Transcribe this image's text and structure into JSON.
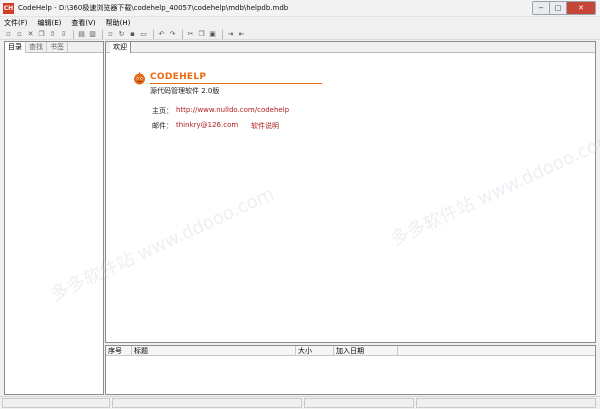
{
  "window": {
    "icon_text": "CH",
    "title": "CodeHelp - D:\\360极速浏览器下载\\codehelp_40057\\codehelp\\mdb\\helpdb.mdb",
    "minimize": "−",
    "maximize": "□",
    "close": "✕"
  },
  "menu": [
    "文件(F)",
    "编辑(E)",
    "查看(V)",
    "帮助(H)"
  ],
  "toolbar_groups": [
    [
      "new-file-icon",
      "open-icon",
      "delete-icon",
      "copy-icon",
      "up-icon",
      "down-icon"
    ],
    [
      "split-horizontal-icon",
      "split-vertical-icon"
    ],
    [
      "new-doc-icon",
      "refresh-icon",
      "save-icon",
      "document-icon"
    ],
    [
      "undo-icon",
      "redo-icon"
    ],
    [
      "cut-icon",
      "copy-text-icon",
      "paste-icon"
    ],
    [
      "arrow-in-icon",
      "arrow-out-icon"
    ]
  ],
  "left_tabs": [
    "目录",
    "查找",
    "书签"
  ],
  "right_tab": "欢迎",
  "welcome": {
    "logo_title": "CODEHELP",
    "subtitle": "源代码管理软件   2.0版",
    "homepage_label": "主页：",
    "homepage_url": "http://www.nulldo.com/codehelp",
    "email_label": "邮件：",
    "email": "thinkry@126.com",
    "manual_link": "软件说明",
    "accent_color": "#e86a12",
    "link_color": "#b11e1e"
  },
  "list_columns": [
    "序号",
    "标题",
    "大小",
    "加入日期"
  ],
  "watermark_text": "多多软件站 www.ddooo.com"
}
